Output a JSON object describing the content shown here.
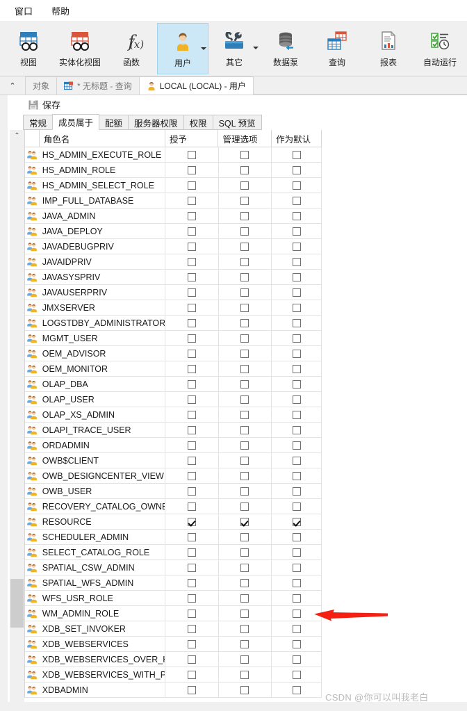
{
  "menubar": {
    "items": [
      {
        "label": "窗口",
        "name": "menu-window"
      },
      {
        "label": "帮助",
        "name": "menu-help"
      }
    ]
  },
  "ribbon": {
    "buttons": [
      {
        "label": "视图",
        "icon": "view-table-icon",
        "active": false,
        "caret": false
      },
      {
        "label": "实体化视图",
        "icon": "materialized-view-icon",
        "active": false,
        "caret": false
      },
      {
        "label": "函数",
        "icon": "function-fx-icon",
        "active": false,
        "caret": false
      },
      {
        "label": "用户",
        "icon": "user-icon",
        "active": true,
        "caret": true
      },
      {
        "label": "其它",
        "icon": "tools-icon",
        "active": false,
        "caret": true
      },
      {
        "label": "数据泵",
        "icon": "data-pump-icon",
        "active": false,
        "caret": false
      },
      {
        "label": "查询",
        "icon": "query-grid-icon",
        "active": false,
        "caret": false
      },
      {
        "label": "报表",
        "icon": "report-icon",
        "active": false,
        "caret": false
      },
      {
        "label": "自动运行",
        "icon": "automation-clock-icon",
        "active": false,
        "caret": false
      }
    ]
  },
  "window_tabs": {
    "collapse_glyph": "⌃",
    "items": [
      {
        "label": "对象",
        "icon": "none",
        "selected": false
      },
      {
        "label": "* 无标题 - 查询",
        "icon": "query-tab-icon",
        "selected": false
      },
      {
        "label": "LOCAL (LOCAL) - 用户",
        "icon": "user-tab-icon",
        "selected": true
      }
    ]
  },
  "toolbar": {
    "save_label": "保存",
    "save_icon": "save-disk-icon"
  },
  "subtabs": {
    "items": [
      {
        "label": "常规",
        "selected": false
      },
      {
        "label": "成员属于",
        "selected": true
      },
      {
        "label": "配额",
        "selected": false
      },
      {
        "label": "服务器权限",
        "selected": false
      },
      {
        "label": "权限",
        "selected": false
      },
      {
        "label": "SQL 预览",
        "selected": false
      }
    ]
  },
  "grid": {
    "headers": [
      "",
      "角色名",
      "授予",
      "管理选项",
      "作为默认"
    ],
    "rows": [
      {
        "role": "HS_ADMIN_EXECUTE_ROLE",
        "grant": false,
        "admin": false,
        "default": false
      },
      {
        "role": "HS_ADMIN_ROLE",
        "grant": false,
        "admin": false,
        "default": false
      },
      {
        "role": "HS_ADMIN_SELECT_ROLE",
        "grant": false,
        "admin": false,
        "default": false
      },
      {
        "role": "IMP_FULL_DATABASE",
        "grant": false,
        "admin": false,
        "default": false
      },
      {
        "role": "JAVA_ADMIN",
        "grant": false,
        "admin": false,
        "default": false
      },
      {
        "role": "JAVA_DEPLOY",
        "grant": false,
        "admin": false,
        "default": false
      },
      {
        "role": "JAVADEBUGPRIV",
        "grant": false,
        "admin": false,
        "default": false
      },
      {
        "role": "JAVAIDPRIV",
        "grant": false,
        "admin": false,
        "default": false
      },
      {
        "role": "JAVASYSPRIV",
        "grant": false,
        "admin": false,
        "default": false
      },
      {
        "role": "JAVAUSERPRIV",
        "grant": false,
        "admin": false,
        "default": false
      },
      {
        "role": "JMXSERVER",
        "grant": false,
        "admin": false,
        "default": false
      },
      {
        "role": "LOGSTDBY_ADMINISTRATOR",
        "grant": false,
        "admin": false,
        "default": false
      },
      {
        "role": "MGMT_USER",
        "grant": false,
        "admin": false,
        "default": false
      },
      {
        "role": "OEM_ADVISOR",
        "grant": false,
        "admin": false,
        "default": false
      },
      {
        "role": "OEM_MONITOR",
        "grant": false,
        "admin": false,
        "default": false
      },
      {
        "role": "OLAP_DBA",
        "grant": false,
        "admin": false,
        "default": false
      },
      {
        "role": "OLAP_USER",
        "grant": false,
        "admin": false,
        "default": false
      },
      {
        "role": "OLAP_XS_ADMIN",
        "grant": false,
        "admin": false,
        "default": false
      },
      {
        "role": "OLAPI_TRACE_USER",
        "grant": false,
        "admin": false,
        "default": false
      },
      {
        "role": "ORDADMIN",
        "grant": false,
        "admin": false,
        "default": false
      },
      {
        "role": "OWB$CLIENT",
        "grant": false,
        "admin": false,
        "default": false
      },
      {
        "role": "OWB_DESIGNCENTER_VIEW",
        "grant": false,
        "admin": false,
        "default": false
      },
      {
        "role": "OWB_USER",
        "grant": false,
        "admin": false,
        "default": false
      },
      {
        "role": "RECOVERY_CATALOG_OWNER",
        "grant": false,
        "admin": false,
        "default": false
      },
      {
        "role": "RESOURCE",
        "grant": true,
        "admin": true,
        "default": true
      },
      {
        "role": "SCHEDULER_ADMIN",
        "grant": false,
        "admin": false,
        "default": false
      },
      {
        "role": "SELECT_CATALOG_ROLE",
        "grant": false,
        "admin": false,
        "default": false
      },
      {
        "role": "SPATIAL_CSW_ADMIN",
        "grant": false,
        "admin": false,
        "default": false
      },
      {
        "role": "SPATIAL_WFS_ADMIN",
        "grant": false,
        "admin": false,
        "default": false
      },
      {
        "role": "WFS_USR_ROLE",
        "grant": false,
        "admin": false,
        "default": false
      },
      {
        "role": "WM_ADMIN_ROLE",
        "grant": false,
        "admin": false,
        "default": false
      },
      {
        "role": "XDB_SET_INVOKER",
        "grant": false,
        "admin": false,
        "default": false
      },
      {
        "role": "XDB_WEBSERVICES",
        "grant": false,
        "admin": false,
        "default": false
      },
      {
        "role": "XDB_WEBSERVICES_OVER_HTTP",
        "grant": false,
        "admin": false,
        "default": false
      },
      {
        "role": "XDB_WEBSERVICES_WITH_PUBLIC",
        "grant": false,
        "admin": false,
        "default": false
      },
      {
        "role": "XDBADMIN",
        "grant": false,
        "admin": false,
        "default": false
      }
    ]
  },
  "scrollbar": {
    "up_glyph": "⌃",
    "down_glyph": "⌄"
  },
  "annotation": {
    "arrow_color": "#f32013",
    "points_at_row": "RESOURCE"
  },
  "watermark": {
    "text": "CSDN @你可以叫我老白"
  },
  "colors": {
    "accent": "#cce8f6",
    "chrome": "#f0f0f0",
    "grid_line": "#e3e3e3"
  }
}
